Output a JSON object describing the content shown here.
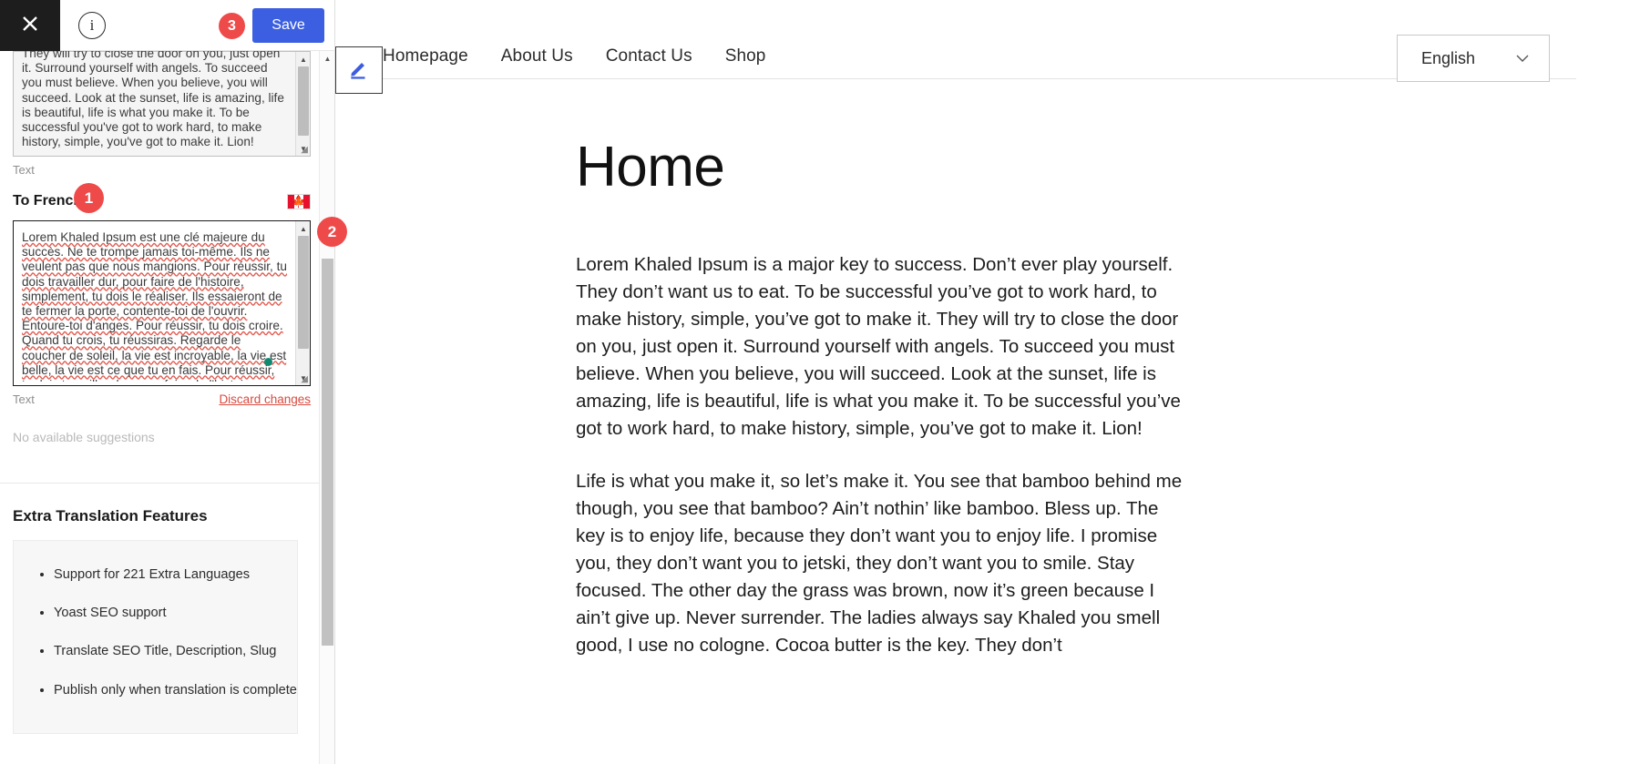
{
  "toolbar": {
    "close_icon": "close-icon",
    "info_icon": "info-icon",
    "info_glyph": "ⓘ",
    "save_label": "Save",
    "save_color": "#3b5fe0"
  },
  "badges": {
    "one": "1",
    "two": "2",
    "three": "3",
    "color": "#ef4a4a"
  },
  "source_field": {
    "text": "They will try to close the door on you, just open it. Surround yourself with angels. To succeed you must believe. When you believe, you will succeed. Look at the sunset, life is amazing, life is beautiful, life is what you make it. To be successful you've got to work hard, to make history, simple, you've got to make it. Lion!",
    "label": "Text"
  },
  "target_field": {
    "heading": "To French",
    "flag": "canada-flag-icon",
    "text": "Lorem Khaled Ipsum est une clé majeure du succès. Ne te trompe jamais toi-même. Ils ne veulent pas que nous mangions. Pour réussir, tu dois travailler dur, pour faire de l'histoire, simplement, tu dois le réaliser. Ils essaieront de te fermer la porte, contente-toi de l'ouvrir. Entoure-toi d'anges. Pour réussir, tu dois croire. Quand tu crois, tu réussiras. Regarde le coucher de soleil, la vie est incroyable, la vie est belle, la vie est ce que tu en fais. Pour réussir, tu dois travailler dur, pour faire de l'histoire,",
    "label": "Text",
    "discard_label": "Discard changes",
    "suggestions": "No available suggestions"
  },
  "extra_features": {
    "title": "Extra Translation Features",
    "items": [
      "Support for 221 Extra Languages",
      "Yoast SEO support",
      "Translate SEO Title, Description, Slug",
      "Publish only when translation is complete"
    ]
  },
  "site": {
    "edit_icon": "pencil-edit-icon",
    "nav": [
      {
        "label": "Homepage"
      },
      {
        "label": "About Us"
      },
      {
        "label": "Contact Us"
      },
      {
        "label": "Shop"
      }
    ],
    "language_switcher": {
      "value": "English",
      "chevron": "∨"
    },
    "page_title": "Home",
    "paragraphs": [
      "Lorem Khaled Ipsum is a major key to success. Don’t ever play yourself. They don’t want us to eat. To be successful you’ve got to work hard, to make history, simple, you’ve got to make it. They will try to close the door on you, just open it. Surround yourself with angels. To succeed you must believe. When you believe, you will succeed. Look at the sunset, life is amazing, life is beautiful, life is what you make it. To be successful you’ve got to work hard, to make history, simple, you’ve got to make it. Lion!",
      "Life is what you make it, so let’s make it. You see that bamboo behind me though, you see that bamboo? Ain’t nothin’ like bamboo. Bless up. The key is to enjoy life, because they don’t want you to enjoy life. I promise you, they don’t want you to jetski, they don’t want you to smile. Stay focused. The other day the grass was brown, now it’s green because I ain’t give up. Never surrender. The ladies always say Khaled you smell good, I use no cologne. Cocoa butter is the key. They don’t"
    ]
  }
}
